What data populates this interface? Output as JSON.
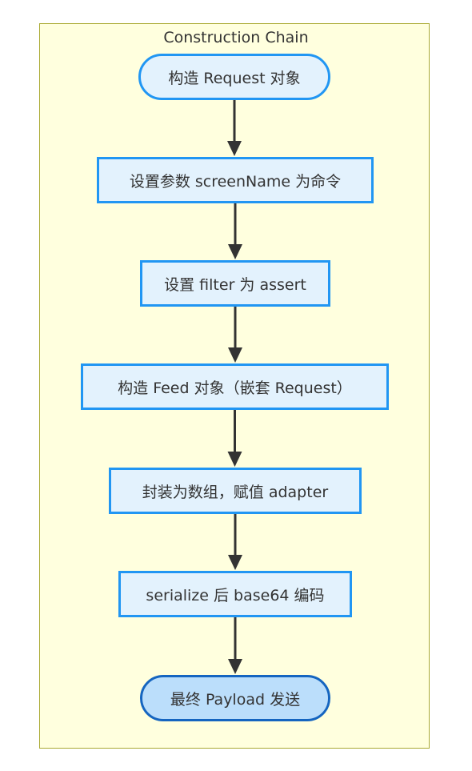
{
  "diagram": {
    "cluster_title": "Construction Chain",
    "nodes": [
      {
        "id": "n1",
        "label": "构造 Request 对象",
        "shape": "stadium"
      },
      {
        "id": "n2",
        "label": "设置参数 screenName 为命令",
        "shape": "rect"
      },
      {
        "id": "n3",
        "label": "设置 filter 为 assert",
        "shape": "rect"
      },
      {
        "id": "n4",
        "label": "构造 Feed 对象（嵌套 Request）",
        "shape": "rect"
      },
      {
        "id": "n5",
        "label": "封装为数组，赋值 adapter",
        "shape": "rect"
      },
      {
        "id": "n6",
        "label": "serialize 后 base64 编码",
        "shape": "rect"
      },
      {
        "id": "n7",
        "label": "最终 Payload 发送",
        "shape": "stadium"
      }
    ],
    "edges": [
      {
        "from": "n1",
        "to": "n2"
      },
      {
        "from": "n2",
        "to": "n3"
      },
      {
        "from": "n3",
        "to": "n4"
      },
      {
        "from": "n4",
        "to": "n5"
      },
      {
        "from": "n5",
        "to": "n6"
      },
      {
        "from": "n6",
        "to": "n7"
      }
    ],
    "colors": {
      "cluster_fill": "#ffffde",
      "cluster_border": "#aaaa33",
      "node_fill": "#e3f2fd",
      "node_border": "#2196f3",
      "end_fill": "#bbdefb",
      "end_border": "#1565c0",
      "edge": "#333333"
    }
  }
}
